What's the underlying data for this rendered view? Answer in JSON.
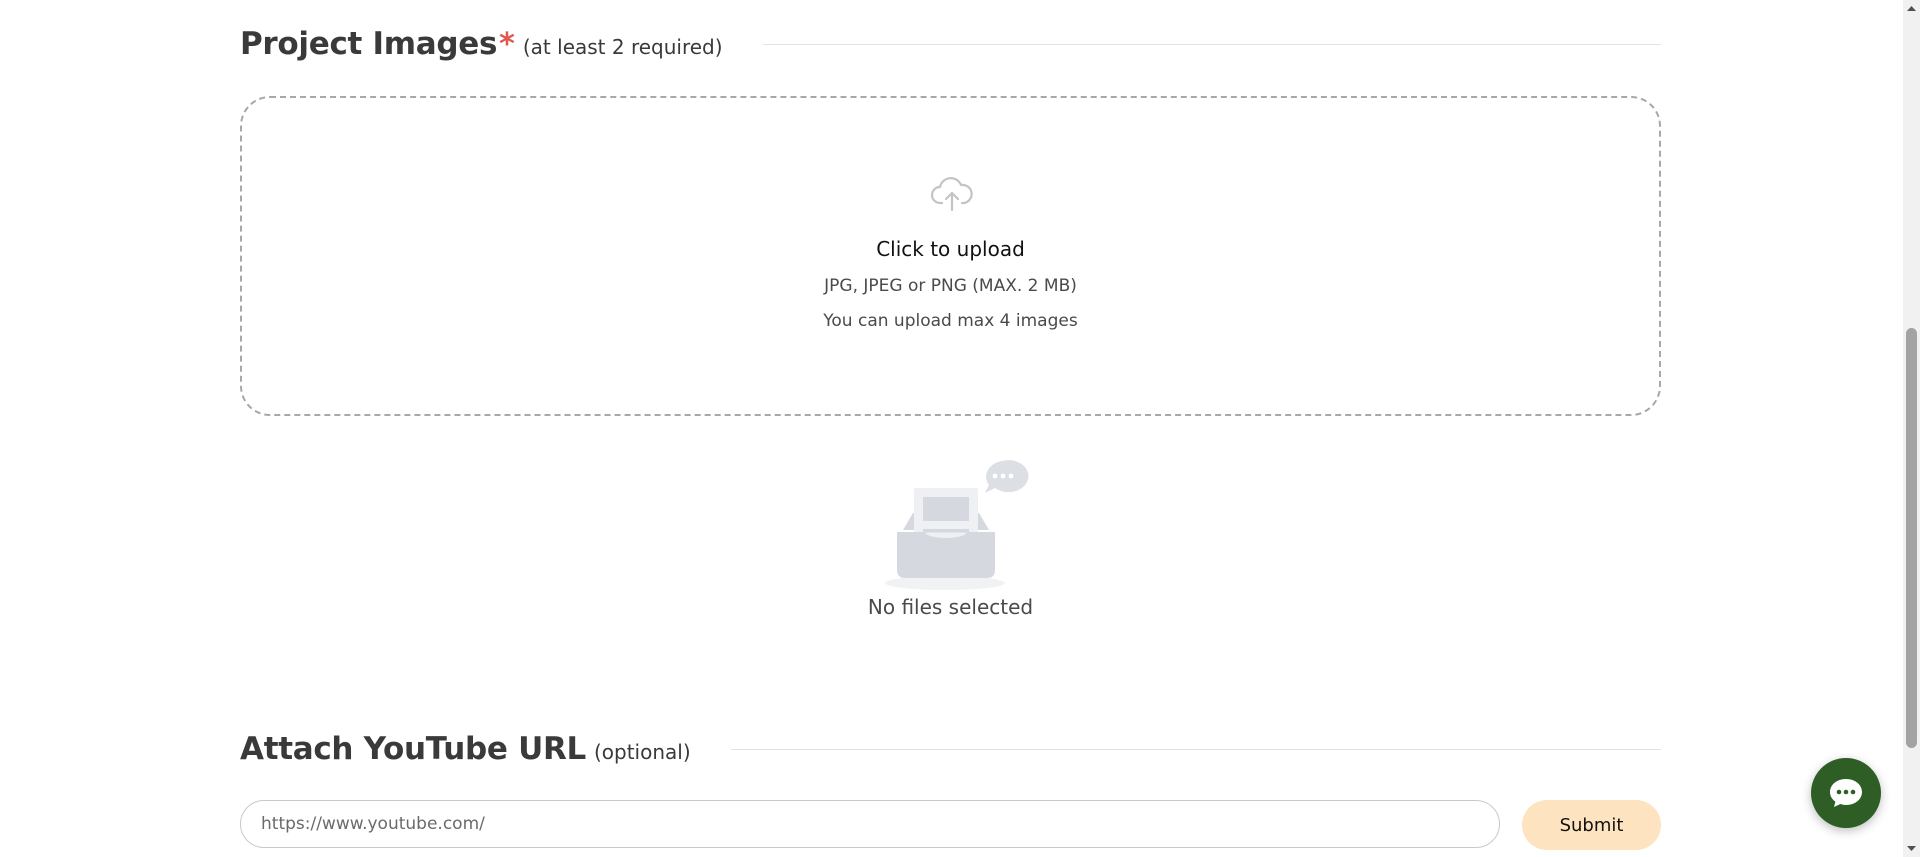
{
  "images_section": {
    "title": "Project Images",
    "required_mark": "*",
    "note": "(at least 2 required)"
  },
  "dropzone": {
    "icon": "cloud-upload-icon",
    "title": "Click to upload",
    "formats": "JPG, JPEG or PNG (MAX. 2 MB)",
    "limit": "You can upload max 4 images"
  },
  "empty_state": {
    "icon": "empty-inbox-illustration",
    "text": "No files selected"
  },
  "youtube_section": {
    "title": "Attach YouTube URL",
    "note": "(optional)"
  },
  "url_input": {
    "placeholder": "https://www.youtube.com/",
    "value": ""
  },
  "submit": {
    "label": "Submit"
  },
  "chat": {
    "icon": "chat-bubble-icon"
  },
  "colors": {
    "accent_required": "#e2574c",
    "submit_bg": "#fde3bf",
    "chat_bg": "#2e5d26"
  }
}
